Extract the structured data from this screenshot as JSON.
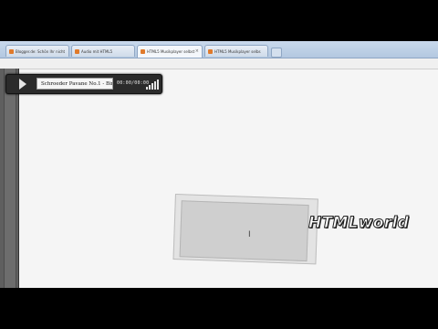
{
  "browser": {
    "tabs": [
      {
        "label": "Blogger.de: Schön Ihr nicht",
        "active": false
      },
      {
        "label": "Audio mit HTML5",
        "active": false
      },
      {
        "label": "HTML5 Musikplayer selbst",
        "active": true
      },
      {
        "label": "HTML5 Musikplayer selbs",
        "active": false
      }
    ],
    "close_glyph": "×"
  },
  "player": {
    "track_title": "Schroeder Pavane No.1 - Birds on",
    "time": "00:00/00:00",
    "play_icon": "play-icon",
    "volume_icon": "volume-bars-icon"
  },
  "watermark": {
    "text": "HTMLworld"
  },
  "cursor": {
    "glyph": "I"
  },
  "colors": {
    "player_bg": "#2b2b2b",
    "tab_active": "#f4f7fb",
    "sidebar": "#5f5f5f"
  }
}
